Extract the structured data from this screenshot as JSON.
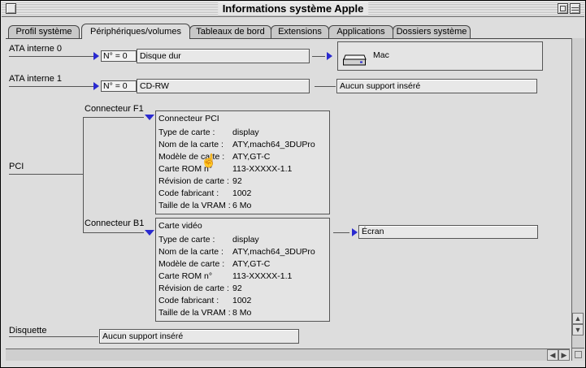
{
  "window": {
    "title": "Informations système Apple"
  },
  "tabs": [
    {
      "label": "Profil système"
    },
    {
      "label": "Périphériques/volumes",
      "active": true
    },
    {
      "label": "Tableaux de bord"
    },
    {
      "label": "Extensions"
    },
    {
      "label": "Applications"
    },
    {
      "label": "Dossiers système"
    }
  ],
  "ata0": {
    "label": "ATA interne 0",
    "number": "N° = 0",
    "device": "Disque dur",
    "volume_name": "Mac",
    "volume_icon": "hard-disk-icon"
  },
  "ata1": {
    "label": "ATA interne 1",
    "number": "N° = 0",
    "device": "CD-RW",
    "status": "Aucun support inséré"
  },
  "pci": {
    "label": "PCI",
    "f1": {
      "label": "Connecteur F1",
      "title": "Connecteur PCI",
      "rows": [
        {
          "key": "Type de carte :",
          "value": "display"
        },
        {
          "key": "Nom de la carte :",
          "value": "ATY,mach64_3DUPro"
        },
        {
          "key": "Modèle de carte :",
          "value": "ATY,GT-C"
        },
        {
          "key": "Carte ROM n°",
          "value": "113-XXXXX-1.1"
        },
        {
          "key": "Révision de carte :",
          "value": "92"
        },
        {
          "key": "Code fabricant :",
          "value": "1002"
        },
        {
          "key": "Taille de la VRAM :",
          "value": "6 Mo"
        }
      ]
    },
    "b1": {
      "label": "Connecteur B1",
      "title": "Carte vidéo",
      "rows": [
        {
          "key": "Type de carte :",
          "value": "display"
        },
        {
          "key": "Nom de la carte :",
          "value": "ATY,mach64_3DUPro"
        },
        {
          "key": "Modèle de carte :",
          "value": "ATY,GT-C"
        },
        {
          "key": "Carte ROM n°",
          "value": "113-XXXXX-1.1"
        },
        {
          "key": "Révision de carte :",
          "value": "92"
        },
        {
          "key": "Code fabricant :",
          "value": "1002"
        },
        {
          "key": "Taille de la VRAM :",
          "value": "8 Mo"
        }
      ],
      "screen_label": "Écran"
    }
  },
  "floppy": {
    "label": "Disquette",
    "status": "Aucun support inséré"
  },
  "colors": {
    "disclosure": "#2a2ad0",
    "background": "#dddddd"
  }
}
